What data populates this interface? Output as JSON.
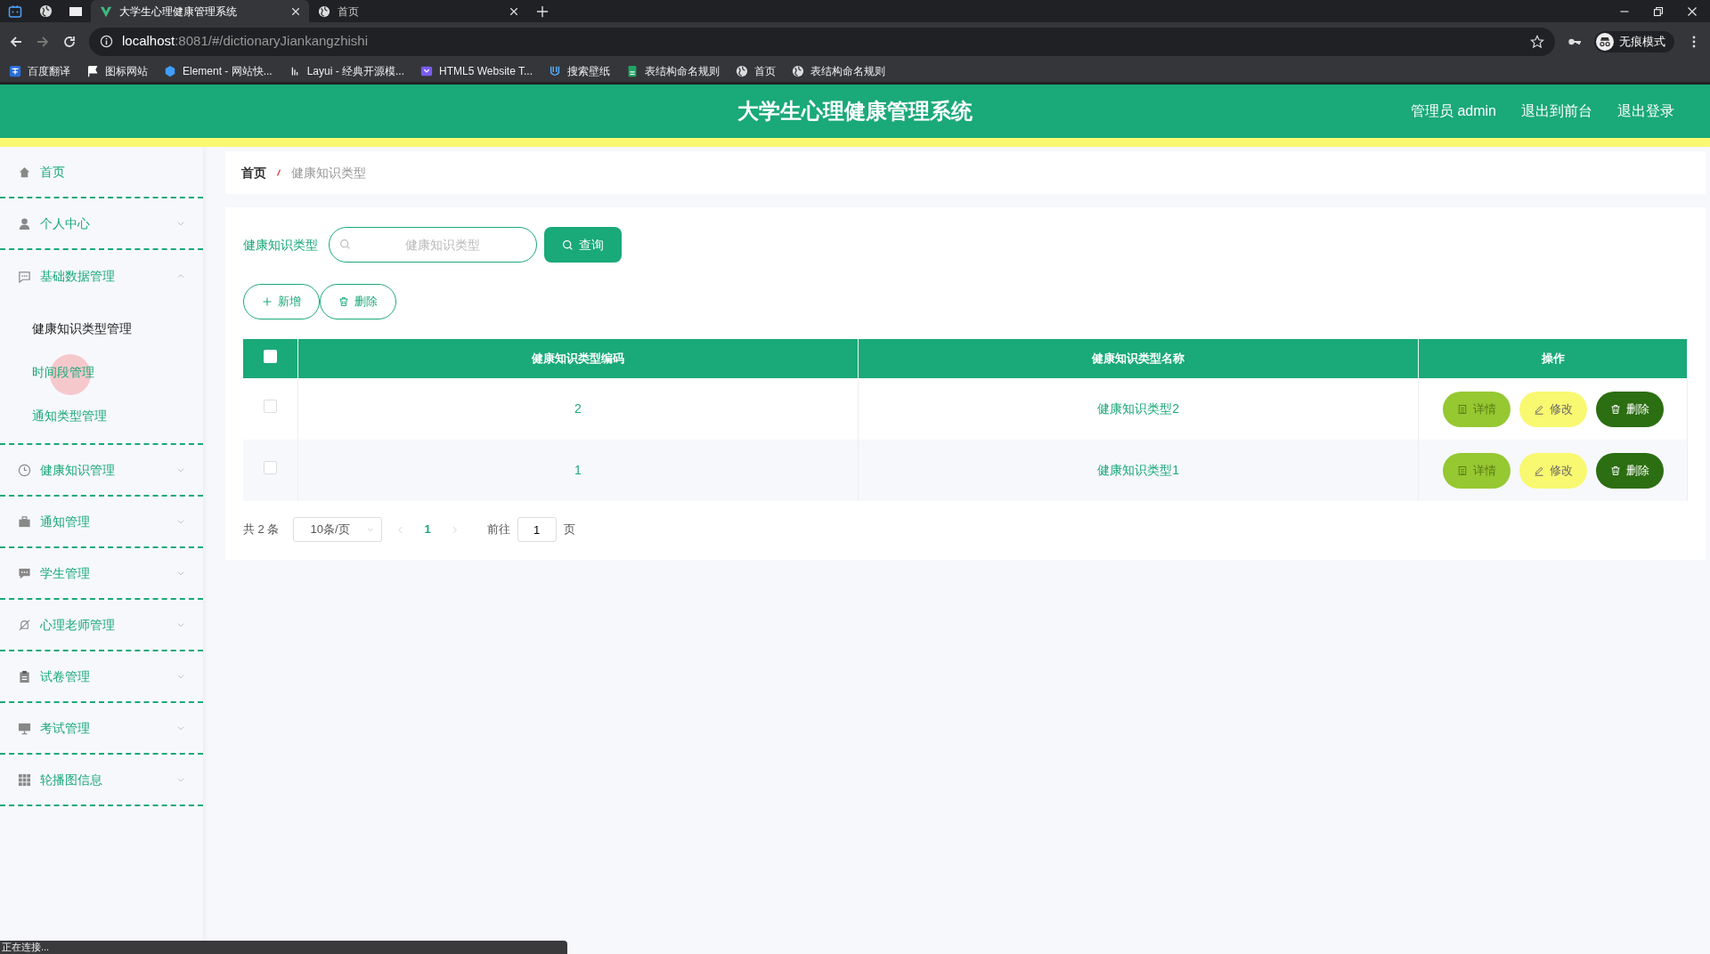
{
  "browser": {
    "tabs": [
      {
        "title": "大学生心理健康管理系统",
        "selected": true
      },
      {
        "title": "首页",
        "selected": false
      }
    ],
    "address": {
      "host": "localhost",
      "path": ":8081/#/dictionaryJiankangzhishi"
    },
    "profile": "无痕模式",
    "bookmarks": [
      "百度翻译",
      "图标网站",
      "Element - 网站快...",
      "Layui - 经典开源模...",
      "HTML5 Website T...",
      "搜索壁纸",
      "表结构命名规则",
      "首页",
      "表结构命名规则"
    ]
  },
  "header": {
    "title": "大学生心理健康管理系统",
    "links": [
      "管理员 admin",
      "退出到前台",
      "退出登录"
    ]
  },
  "sidebar": {
    "items": [
      {
        "label": "首页"
      },
      {
        "label": "个人中心",
        "expanded": false
      },
      {
        "label": "基础数据管理",
        "expanded": true,
        "children": [
          {
            "label": "健康知识类型管理",
            "selected": true
          },
          {
            "label": "时间段管理",
            "selected": false
          },
          {
            "label": "通知类型管理",
            "selected": false
          }
        ]
      },
      {
        "label": "健康知识管理",
        "expanded": false
      },
      {
        "label": "通知管理",
        "expanded": false
      },
      {
        "label": "学生管理",
        "expanded": false
      },
      {
        "label": "心理老师管理",
        "expanded": false
      },
      {
        "label": "试卷管理",
        "expanded": false
      },
      {
        "label": "考试管理",
        "expanded": false
      },
      {
        "label": "轮播图信息",
        "expanded": false
      }
    ]
  },
  "breadcrumb": [
    "首页",
    "健康知识类型"
  ],
  "search": {
    "label": "健康知识类型",
    "placeholder": "健康知识类型",
    "button": "查询"
  },
  "actions": [
    {
      "label": "新增",
      "kind": "add"
    },
    {
      "label": "删除",
      "kind": "delete"
    }
  ],
  "table": {
    "columns": [
      "健康知识类型编码",
      "健康知识类型名称",
      "操作"
    ],
    "all_checked": false,
    "rows": [
      {
        "code": "2",
        "name": "健康知识类型2",
        "checked": false,
        "actions": [
          {
            "label": "详情",
            "kind": "detail"
          },
          {
            "label": "修改",
            "kind": "edit"
          },
          {
            "label": "删除",
            "kind": "delete"
          }
        ]
      },
      {
        "code": "1",
        "name": "健康知识类型1",
        "checked": false,
        "actions": [
          {
            "label": "详情",
            "kind": "detail"
          },
          {
            "label": "修改",
            "kind": "edit"
          },
          {
            "label": "删除",
            "kind": "delete"
          }
        ]
      }
    ]
  },
  "pagination": {
    "total": "共 2 条",
    "page_size": "10条/页",
    "pages": [
      {
        "label": "1",
        "selected": true
      }
    ],
    "goto": "前往",
    "goto_value": "1",
    "page_unit": "页"
  },
  "status_bar": "正在连接..."
}
